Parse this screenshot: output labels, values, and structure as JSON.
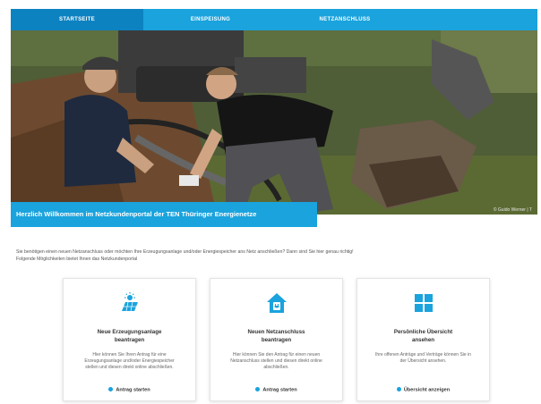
{
  "nav": {
    "tabs": [
      {
        "label": "STARTSEITE",
        "active": true
      },
      {
        "label": "EINSPEISUNG",
        "active": false
      },
      {
        "label": "NETZANSCHLUSS",
        "active": false
      }
    ]
  },
  "hero": {
    "credit": "© Guido Werner | T"
  },
  "banner": {
    "text": "Herzlich Willkommen im Netzkundenportal der TEN Thüringer Energienetze"
  },
  "intro": {
    "line1": "Sie benötigen einen neuen Netzanschluss oder möchten Ihre Erzeugungsanlage und/oder Energiespeicher ans Netz anschließen? Dann sind Sie hier genau richtig!",
    "line2": "Folgende Möglichkeiten bietet Ihnen das Netzkundenportal"
  },
  "cards": [
    {
      "icon": "solar-panel-icon",
      "title_line1": "Neue Erzeugungsanlage",
      "title_line2": "beantragen",
      "desc_line1": "Hier können Sie Ihren Antrag für eine",
      "desc_line2": "Erzeugungsanlage und/oder Energiespeicher",
      "desc_line3": "stellen und diesen direkt online abschließen.",
      "action": "Antrag starten"
    },
    {
      "icon": "house-plug-icon",
      "title_line1": "Neuen Netzanschluss",
      "title_line2": "beantragen",
      "desc_line1": "Hier können Sie den Antrag für einen neuen",
      "desc_line2": "Netzanschluss stellen und diesen direkt online",
      "desc_line3": "abschließen.",
      "action": "Antrag starten"
    },
    {
      "icon": "grid-overview-icon",
      "title_line1": "Persönliche Übersicht",
      "title_line2": "ansehen",
      "desc_line1": "Ihre offenen Anträge und Verträge können Sie in",
      "desc_line2": "der Übersicht ansehen.",
      "desc_line3": "",
      "action": "Übersicht anzeigen"
    }
  ],
  "colors": {
    "brand": "#1aa3dd",
    "nav_active": "#0d82c1"
  }
}
